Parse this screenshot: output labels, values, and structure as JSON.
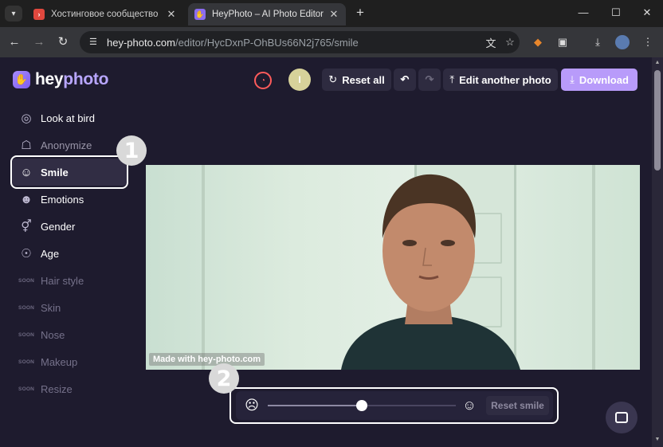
{
  "browser": {
    "tabs": [
      {
        "title": "Хостинговое сообщество «Tim",
        "favicon": "youtube-like-icon",
        "active": false
      },
      {
        "title": "HeyPhoto – AI Photo Editor On",
        "favicon": "heyphoto-icon",
        "active": true
      }
    ],
    "url_host": "hey-photo.com",
    "url_path": "/editor/HycDxnP-OhBUs66N2j765/smile"
  },
  "header": {
    "logo_hey": "hey",
    "logo_photo": "photo",
    "avatar_initial": "I",
    "reset_all": "Reset all",
    "edit_another": "Edit another photo",
    "download": "Download"
  },
  "sidebar": {
    "items": [
      {
        "label": "Look at bird",
        "icon": "bird-face-icon",
        "state": "normal"
      },
      {
        "label": "Anonymize",
        "icon": "mask-icon",
        "state": "dim"
      },
      {
        "label": "Smile",
        "icon": "smile-icon",
        "state": "selected"
      },
      {
        "label": "Emotions",
        "icon": "emotions-icon",
        "state": "normal"
      },
      {
        "label": "Gender",
        "icon": "gender-icon",
        "state": "normal"
      },
      {
        "label": "Age",
        "icon": "age-icon",
        "state": "normal"
      },
      {
        "label": "Hair style",
        "icon": "soon-badge",
        "state": "soon"
      },
      {
        "label": "Skin",
        "icon": "soon-badge",
        "state": "soon"
      },
      {
        "label": "Nose",
        "icon": "soon-badge",
        "state": "soon"
      },
      {
        "label": "Makeup",
        "icon": "soon-badge",
        "state": "soon"
      },
      {
        "label": "Resize",
        "icon": "soon-badge",
        "state": "soon"
      }
    ],
    "soon_label": "SOON"
  },
  "photo": {
    "watermark": "Made with hey-photo.com"
  },
  "smile_control": {
    "level_fraction": 0.5,
    "reset_label": "Reset smile"
  },
  "callouts": {
    "step1": "1",
    "step2": "2"
  },
  "colors": {
    "accent": "#b89bfa",
    "background": "#1e1b2e"
  }
}
